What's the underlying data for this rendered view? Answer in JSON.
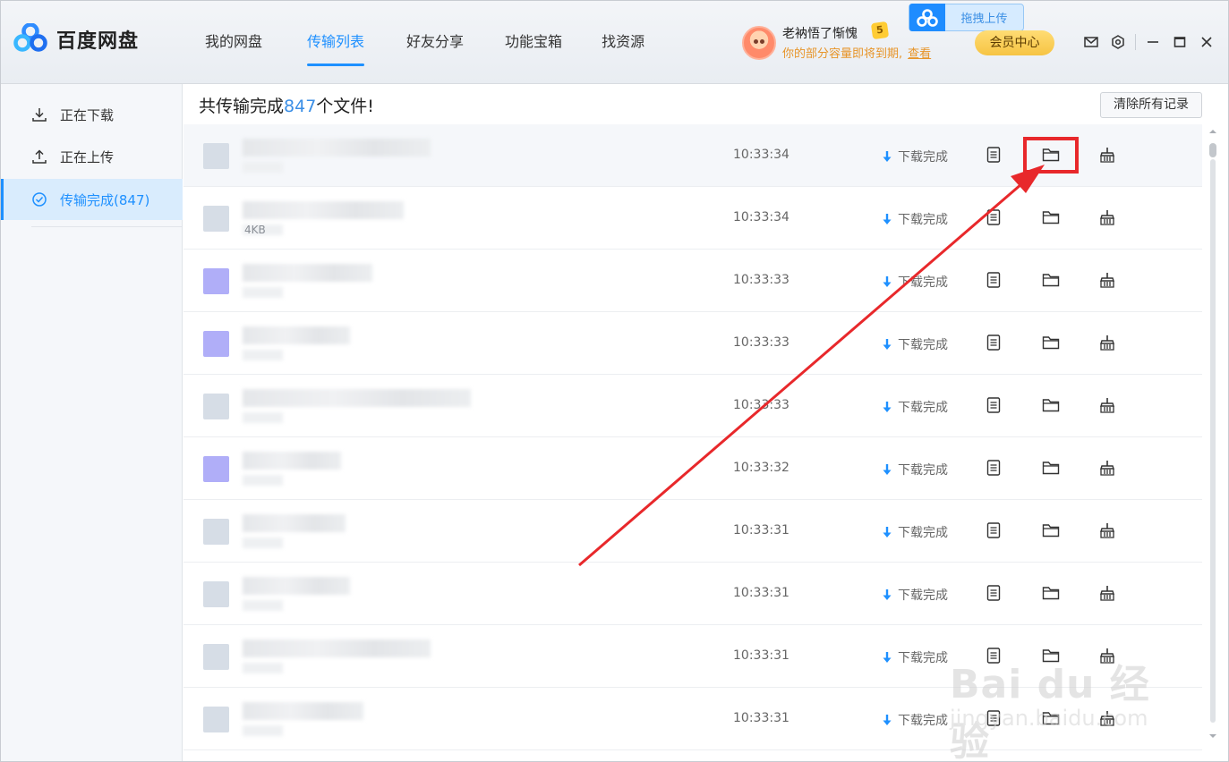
{
  "app": {
    "name": "百度网盘"
  },
  "nav": {
    "items": [
      {
        "label": "我的网盘",
        "active": false
      },
      {
        "label": "传输列表",
        "active": true
      },
      {
        "label": "好友分享",
        "active": false
      },
      {
        "label": "功能宝箱",
        "active": false
      },
      {
        "label": "找资源",
        "active": false
      }
    ]
  },
  "user": {
    "name": "老衲悟了惭愧",
    "vip_level": "5",
    "notice": "你的部分容量即将到期,",
    "notice_link": "查看"
  },
  "header": {
    "upload_label": "拖拽上传",
    "member_label": "会员中心"
  },
  "sidebar": {
    "items": [
      {
        "label": "正在下载",
        "icon": "download-icon",
        "active": false
      },
      {
        "label": "正在上传",
        "icon": "upload-icon",
        "active": false
      },
      {
        "label": "传输完成(847)",
        "icon": "check-circle-icon",
        "active": true
      }
    ]
  },
  "main": {
    "summary_prefix": "共传输完成",
    "summary_count": "847",
    "summary_suffix": "个文件!",
    "clear_label": "清除所有记录"
  },
  "transfers": [
    {
      "time": "10:33:34",
      "status": "下载完成",
      "size": "",
      "thumb": "gray"
    },
    {
      "time": "10:33:34",
      "status": "下载完成",
      "size": "4KB",
      "thumb": "gray"
    },
    {
      "time": "10:33:33",
      "status": "下载完成",
      "size": "",
      "thumb": "purple"
    },
    {
      "time": "10:33:33",
      "status": "下载完成",
      "size": "",
      "thumb": "purple"
    },
    {
      "time": "10:33:33",
      "status": "下载完成",
      "size": "",
      "thumb": "gray"
    },
    {
      "time": "10:33:32",
      "status": "下载完成",
      "size": "",
      "thumb": "purple"
    },
    {
      "time": "10:33:31",
      "status": "下载完成",
      "size": "",
      "thumb": "gray"
    },
    {
      "time": "10:33:31",
      "status": "下载完成",
      "size": "",
      "thumb": "gray"
    },
    {
      "time": "10:33:31",
      "status": "下载完成",
      "size": "",
      "thumb": "gray"
    },
    {
      "time": "10:33:31",
      "status": "下载完成",
      "size": "",
      "thumb": "gray"
    }
  ],
  "watermark": {
    "main": "Bai du 经验",
    "sub": "jingyan.baidu.com"
  },
  "colors": {
    "accent": "#1e90ff",
    "annotation": "#e8282b",
    "notice": "#e7952a",
    "member_gold": "#f6c443"
  }
}
